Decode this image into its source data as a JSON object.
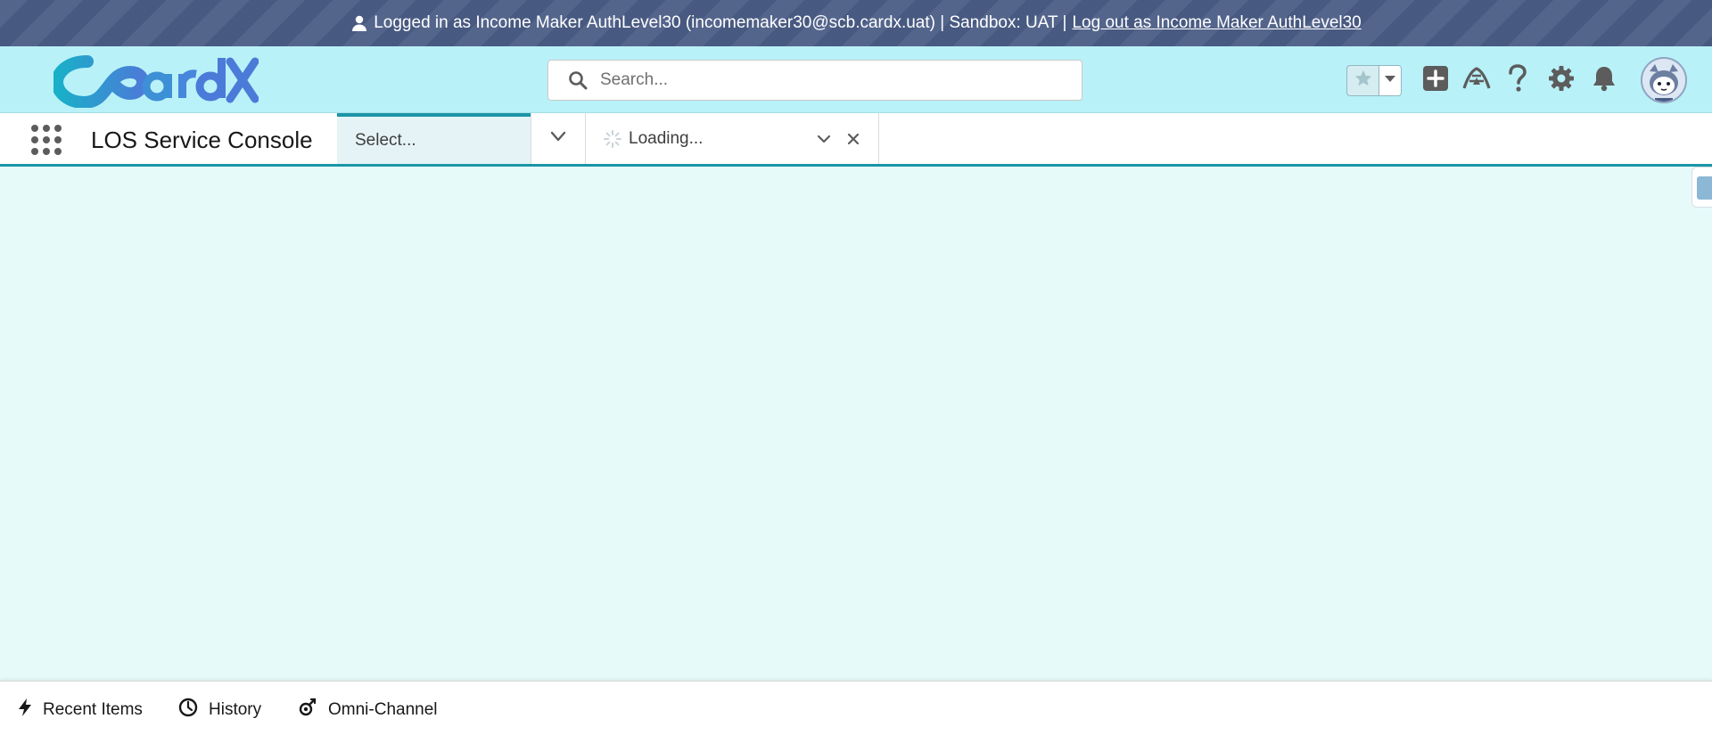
{
  "banner": {
    "message": "Logged in as Income Maker AuthLevel30 (incomemaker30@scb.cardx.uat) | Sandbox: UAT |",
    "logout_label": "Log out as Income Maker AuthLevel30"
  },
  "header": {
    "logo_text": "CardX",
    "search_placeholder": "Search...",
    "icons": [
      "star-icon",
      "chevron-down-icon",
      "add-icon",
      "trailhead-icon",
      "help-icon",
      "settings-icon",
      "bell-icon",
      "avatar"
    ]
  },
  "navbar": {
    "app_name": "LOS Service Console",
    "select_tab_label": "Select...",
    "loading_tab_label": "Loading..."
  },
  "utility_bar": {
    "items": [
      {
        "label": "Recent Items",
        "icon": "lightning-icon"
      },
      {
        "label": "History",
        "icon": "clock-icon"
      },
      {
        "label": "Omni-Channel",
        "icon": "omni-channel-icon"
      }
    ]
  },
  "colors": {
    "banner_bg": "#4b5d86",
    "header_bg": "#b9f1f8",
    "workspace_bg": "#e6fafa",
    "accent": "#1b96a8",
    "logo_primary": "#1fa6cf",
    "logo_secondary": "#4b7bd8"
  }
}
